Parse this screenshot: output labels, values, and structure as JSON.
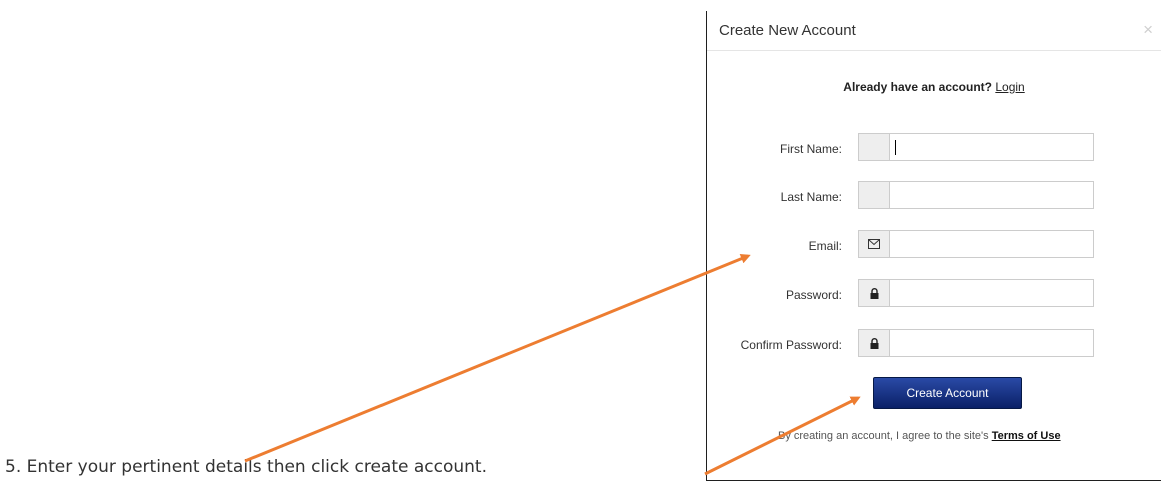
{
  "modal": {
    "title": "Create New Account",
    "close_symbol": "×",
    "login_prompt": "Already have an account?",
    "login_link": "Login"
  },
  "form": {
    "fields": [
      {
        "label": "First Name:",
        "icon": "blank",
        "value": ""
      },
      {
        "label": "Last Name:",
        "icon": "blank",
        "value": ""
      },
      {
        "label": "Email:",
        "icon": "envelope-icon",
        "value": ""
      },
      {
        "label": "Password:",
        "icon": "lock-icon",
        "value": ""
      },
      {
        "label": "Confirm Password:",
        "icon": "lock-icon",
        "value": ""
      }
    ],
    "submit_label": "Create Account",
    "terms_text": "By creating an account, I agree to the site's",
    "terms_link": "Terms of Use"
  },
  "instruction": "5.   Enter your pertinent details then click create account.",
  "colors": {
    "arrow": "#ed7d31",
    "button_top": "#2a4aa6",
    "button_bottom": "#0a2067"
  }
}
